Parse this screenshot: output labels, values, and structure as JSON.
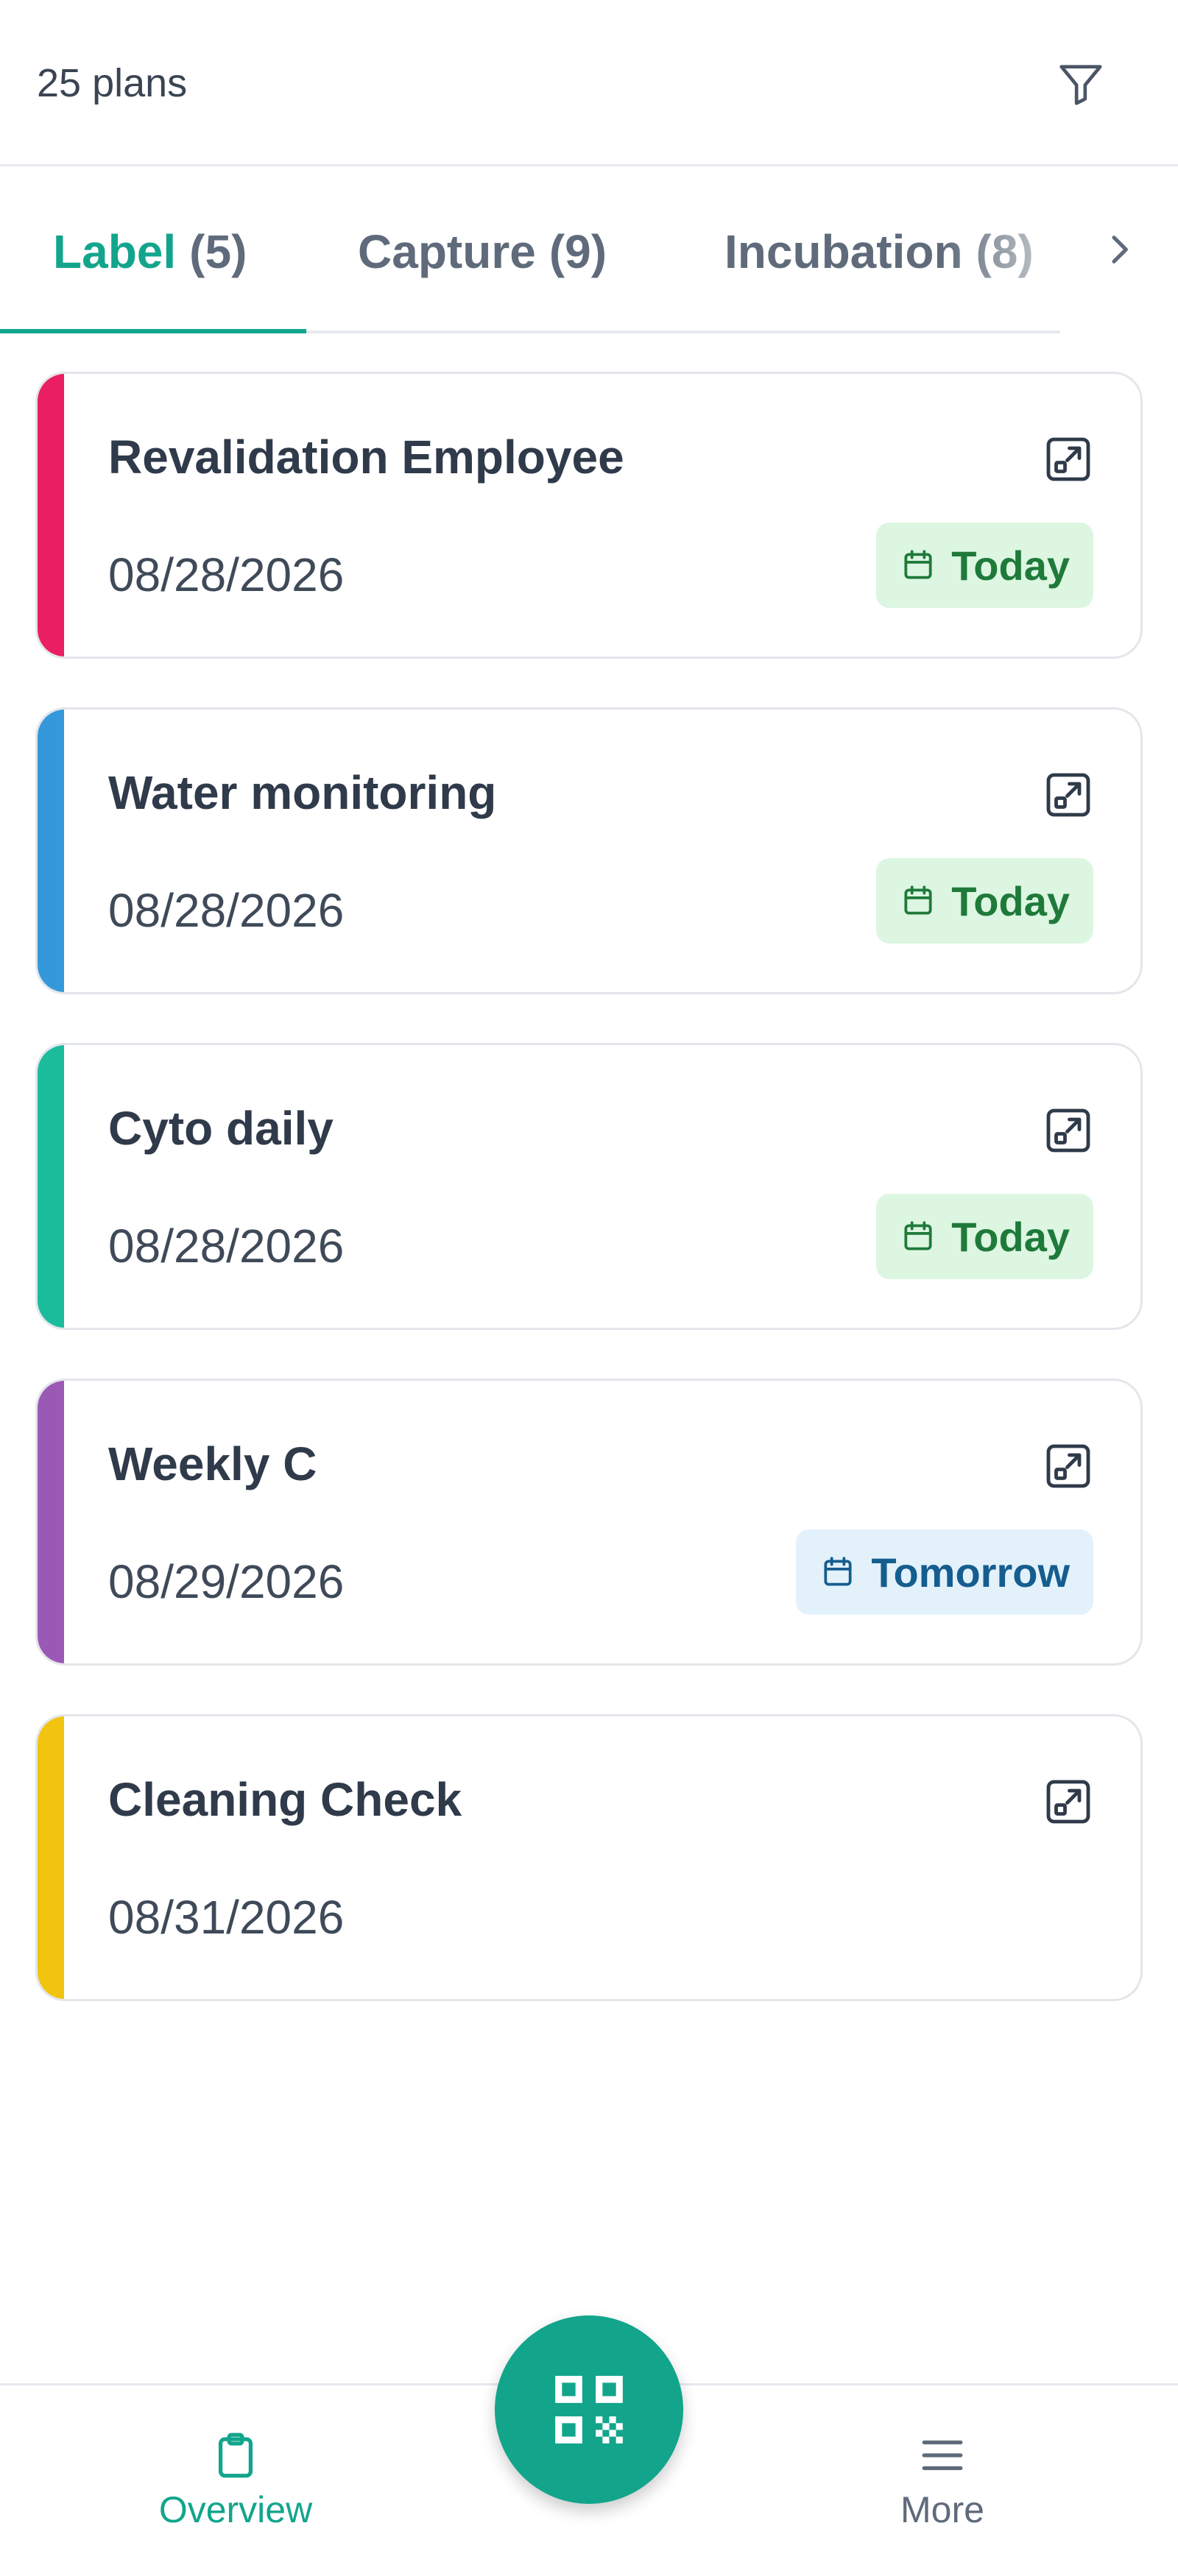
{
  "header": {
    "plan_count": "25 plans",
    "filter_icon": "filter-icon"
  },
  "tabs": [
    {
      "label": "Label",
      "count": "(5)",
      "active": true
    },
    {
      "label": "Capture",
      "count": "(9)",
      "active": false
    },
    {
      "label": "Incubation",
      "count": "(8)",
      "active": false
    }
  ],
  "tabs_next_icon": "chevron-right-icon",
  "plans": [
    {
      "title": "Revalidation Employee",
      "date": "08/28/2026",
      "badge": "Today",
      "badge_type": "today",
      "color": "#e91e63"
    },
    {
      "title": "Water monitoring",
      "date": "08/28/2026",
      "badge": "Today",
      "badge_type": "today",
      "color": "#3498db"
    },
    {
      "title": "Cyto daily",
      "date": "08/28/2026",
      "badge": "Today",
      "badge_type": "today",
      "color": "#1abc9c"
    },
    {
      "title": "Weekly C",
      "date": "08/29/2026",
      "badge": "Tomorrow",
      "badge_type": "tomorrow",
      "color": "#9b59b6"
    },
    {
      "title": "Cleaning Check",
      "date": "08/31/2026",
      "badge": "",
      "badge_type": "none",
      "color": "#f1c40f"
    }
  ],
  "bottom_nav": {
    "overview_label": "Overview",
    "more_label": "More",
    "scan_icon": "qr-code-icon"
  },
  "colors": {
    "accent": "#12a58c",
    "today_bg": "#dcf6e2",
    "today_text": "#1f7a3a",
    "tomorrow_bg": "#e3f1fb",
    "tomorrow_text": "#155d8f"
  }
}
